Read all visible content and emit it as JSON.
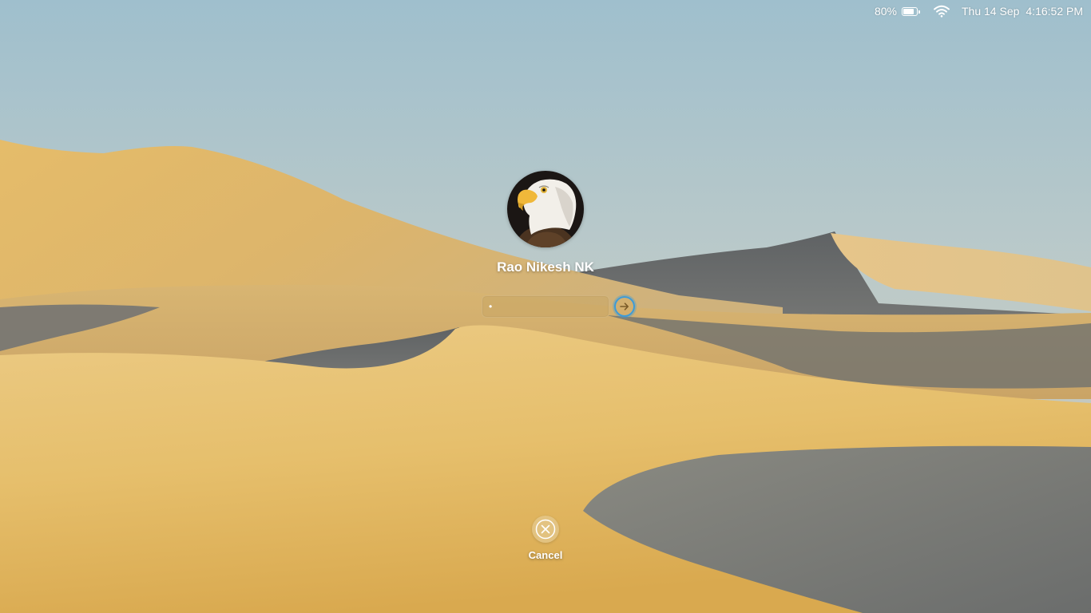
{
  "status_bar": {
    "battery_percent_label": "80%",
    "battery_level": 0.8,
    "date": "Thu 14 Sep",
    "time": "4:16:52 PM",
    "wifi_icon": "wifi-icon",
    "battery_icon": "battery-icon"
  },
  "login": {
    "user_name": "Rao Nikesh NK",
    "avatar_icon": "eagle-avatar",
    "password_value": "•",
    "submit_icon": "arrow-right-icon",
    "accent_color": "#3d9bd8"
  },
  "cancel": {
    "label": "Cancel",
    "icon": "close-circle-icon"
  },
  "wallpaper": {
    "description_colors": {
      "sky": "#a9c3cd",
      "sand": "#e0b463",
      "shadow": "#6d7072"
    }
  }
}
